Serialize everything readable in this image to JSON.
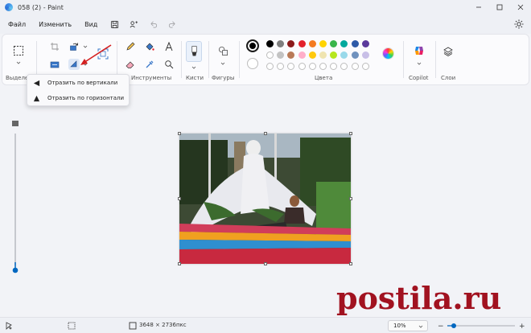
{
  "window": {
    "title": "058 (2) - Paint"
  },
  "menu": {
    "file": "Файл",
    "edit": "Изменить",
    "view": "Вид"
  },
  "ribbon": {
    "selection_label": "Выделе",
    "tools_label": "Инструменты",
    "brushes_label": "Кисти",
    "shapes_label": "Фигуры",
    "colors_label": "Цвета",
    "copilot_label": "Copilot",
    "layers_label": "Слои"
  },
  "flyout": {
    "flip_vertical": "Отразить по вертикали",
    "flip_horizontal": "Отразить по горизонтали"
  },
  "colors": {
    "row1": [
      "#000000",
      "#7f7f7f",
      "#8b1a1a",
      "#e3212b",
      "#f47b20",
      "#ffd400",
      "#39b54a",
      "#00a99d",
      "#2e5aa7",
      "#5b3a9c"
    ],
    "row2_filled": [
      "#ffffff",
      "#c3c3c3",
      "#b97a57",
      "#ffaec9",
      "#ffc90e",
      "#efe4b0",
      "#b5e61d",
      "#99d9ea",
      "#7092be",
      "#c8bfe7"
    ],
    "primary": "#000000",
    "secondary": "#ffffff",
    "accent": "#0067c0"
  },
  "status": {
    "image_size": "3648 × 2736пкс",
    "zoom": "10%"
  },
  "watermark": {
    "text": "postila.ru"
  }
}
